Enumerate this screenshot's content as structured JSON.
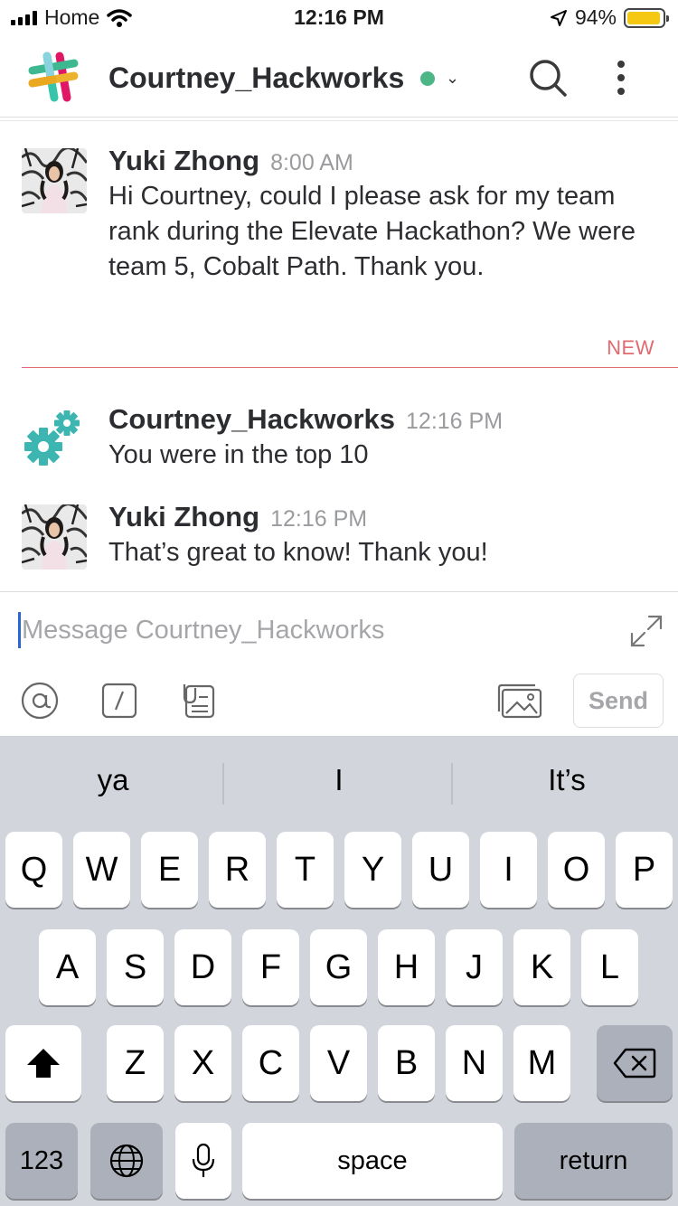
{
  "status_bar": {
    "carrier": "Home",
    "time": "12:16 PM",
    "battery": "94%",
    "battery_level": 0.94
  },
  "header": {
    "title": "Courtney_Hackworks",
    "presence_color": "#4cb686"
  },
  "messages": [
    {
      "author": "Yuki Zhong",
      "time": "8:00 AM",
      "text": "Hi Courtney, could I please ask for my team rank during the Elevate Hackathon? We were team 5, Cobalt Path. Thank you."
    },
    {
      "author": "Courtney_Hackworks",
      "time": "12:16 PM",
      "text": "You were in the top 10"
    },
    {
      "author": "Yuki Zhong",
      "time": "12:16 PM",
      "text": "That’s great to know! Thank you!"
    }
  ],
  "new_divider": "NEW",
  "composer": {
    "placeholder": "Message Courtney_Hackworks",
    "send_label": "Send"
  },
  "keyboard": {
    "suggestions": [
      "ya",
      "I",
      "It’s"
    ],
    "row1": [
      "Q",
      "W",
      "E",
      "R",
      "T",
      "Y",
      "U",
      "I",
      "O",
      "P"
    ],
    "row2": [
      "A",
      "S",
      "D",
      "F",
      "G",
      "H",
      "J",
      "K",
      "L"
    ],
    "row3": [
      "Z",
      "X",
      "C",
      "V",
      "B",
      "N",
      "M"
    ],
    "numbers_label": "123",
    "space_label": "space",
    "return_label": "return"
  }
}
